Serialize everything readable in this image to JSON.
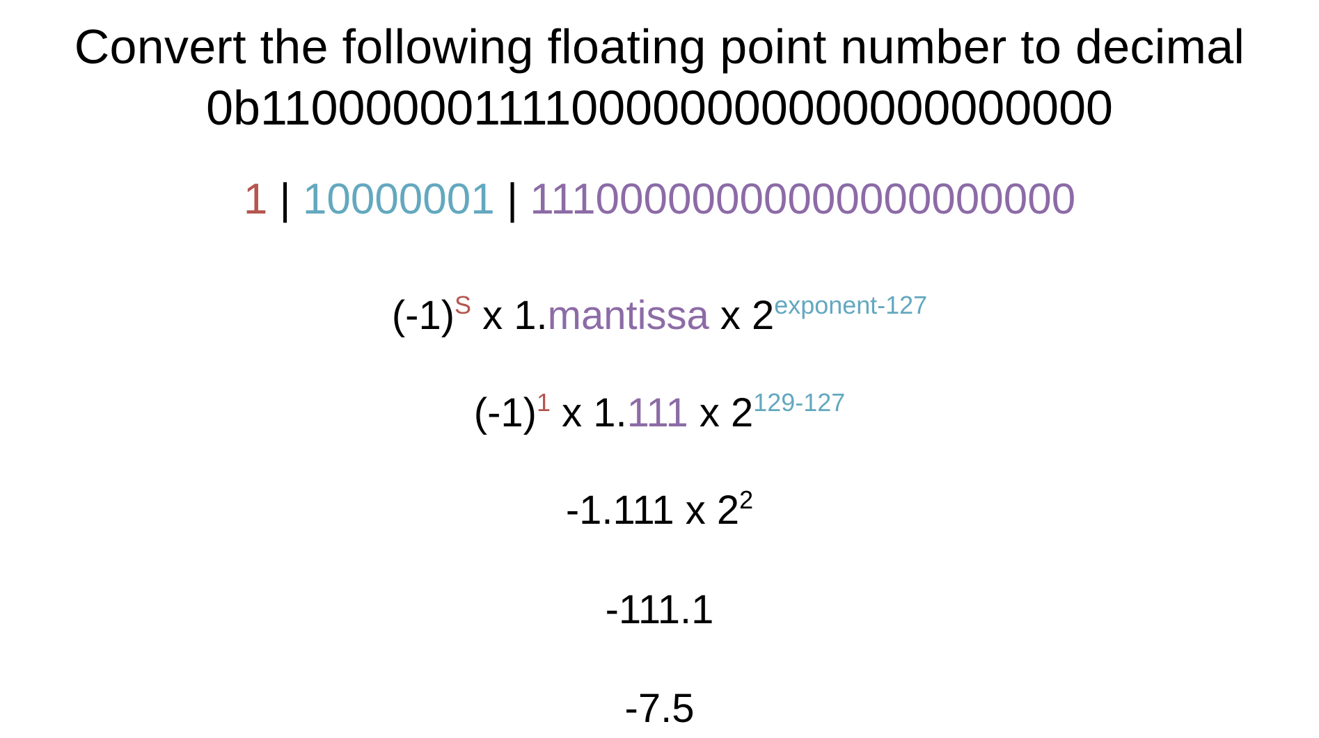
{
  "colors": {
    "sign": "#b5554f",
    "exponent": "#63a8bf",
    "mantissa": "#8c6ba6",
    "text": "#000000",
    "background": "#ffffff"
  },
  "title": "Convert the following floating point number to decimal",
  "binary": "0b11000000111100000000000000000000",
  "split": {
    "sign": "1",
    "sep1": "|",
    "exponent": "10000001",
    "sep2": "|",
    "mantissa": "11100000000000000000000"
  },
  "formula": {
    "base": "(-1)",
    "sign_sup": "S",
    "times1": " x 1.",
    "mantissa_word": "mantissa",
    "times2": " x 2",
    "exp_sup": "exponent-127"
  },
  "step2": {
    "base": "(-1)",
    "sign_sup": "1",
    "times1": " x 1.",
    "mantissa_value": "111",
    "times2": " x 2",
    "exp_sup": "129-127"
  },
  "step3": {
    "text": "-1.111 x 2",
    "exp_sup": "2"
  },
  "step4": "-111.1",
  "step5": "-7.5"
}
